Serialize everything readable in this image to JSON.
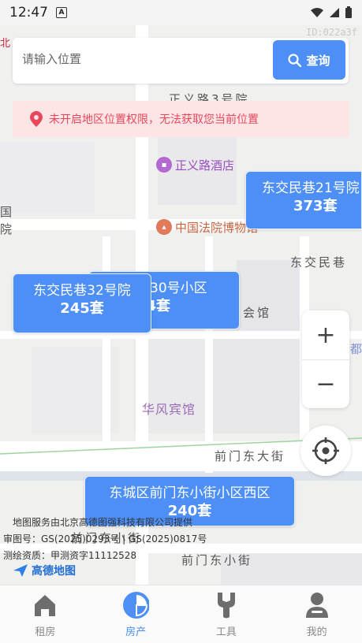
{
  "status_bar": {
    "time": "12:47",
    "notif_letter": "A"
  },
  "map": {
    "id_text": "ID:022a3f",
    "road_labels": {
      "zhengyi_road": "正义路3号院",
      "dongjiaomin": "东交民巷",
      "qianmen_east": "前门东大街",
      "qianmen_xiaojie": "前门东小街",
      "qianmen_xiaojie2": "前门东小街"
    },
    "area_labels": {
      "guo_yuan": "国\n院",
      "huiguan": "会馆",
      "du": "都",
      "huafeng": "华风宾馆",
      "north": "北"
    },
    "pois": {
      "hotel": "正义路酒店",
      "museum": "中国法院博物馆"
    },
    "markers": [
      {
        "name": "东交民巷21号院",
        "count": "373套"
      },
      {
        "name": "巷30号小区",
        "count": "04套"
      },
      {
        "name": "东交民巷32号院",
        "count": "245套"
      },
      {
        "name": "东城区前门东小街小区西区",
        "count": "240套"
      }
    ],
    "attribution": {
      "line1": "地图服务由北京高德图强科技有限公司提供",
      "line2": "审图号：GS(2025)0293号 | GS(2025)0817号",
      "line3": "测绘资质：甲测资字11112528",
      "logo": "高德地图"
    }
  },
  "search": {
    "placeholder": "请输入位置",
    "button": "查询"
  },
  "alert": {
    "text": "未开启地区位置权限，无法获取您当前位置"
  },
  "zoom": {
    "in": "+",
    "out": "−"
  },
  "nav": [
    {
      "label": "租房",
      "icon": "home-icon"
    },
    {
      "label": "房产",
      "icon": "pie-chart-icon"
    },
    {
      "label": "工具",
      "icon": "wrench-icon"
    },
    {
      "label": "我的",
      "icon": "user-icon"
    }
  ],
  "colors": {
    "accent": "#4d8ff6",
    "alert_bg": "#fde5e6",
    "alert_text": "#e8485d"
  }
}
